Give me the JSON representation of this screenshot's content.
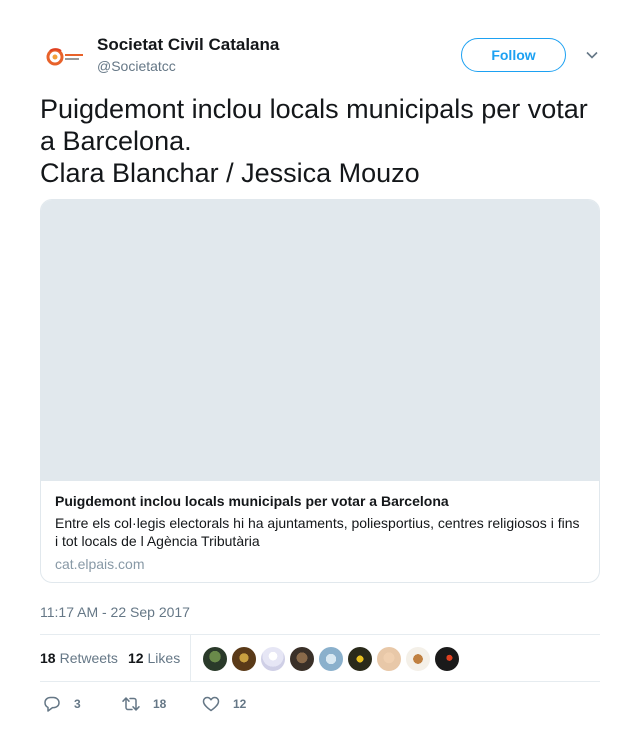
{
  "account": {
    "display_name": "Societat Civil Catalana",
    "handle": "@Societatcc",
    "follow_label": "Follow"
  },
  "tweet": {
    "line1": "Puigdemont inclou locals municipals per votar",
    "line2": "a Barcelona.",
    "line3": "Clara Blanchar / Jessica Mouzo"
  },
  "card": {
    "title": "Puigdemont inclou locals municipals per votar a Barcelona",
    "description": "Entre els col·legis electorals hi ha ajuntaments, poliesportius, centres religiosos i fins i tot locals de l Agència Tributària",
    "domain": "cat.elpais.com"
  },
  "timestamp": "11:17 AM - 22 Sep 2017",
  "stats": {
    "retweets_count": "18",
    "retweets_label": "Retweets",
    "likes_count": "12",
    "likes_label": "Likes"
  },
  "actions": {
    "reply_count": "3",
    "retweet_count": "18",
    "like_count": "12"
  },
  "colors": {
    "accent": "#1da1f2",
    "secondary_text": "#657786",
    "border": "#e1e8ed"
  },
  "icons": [
    "logo-icon",
    "chevron-down-icon",
    "reply-icon",
    "retweet-icon",
    "heart-icon"
  ]
}
